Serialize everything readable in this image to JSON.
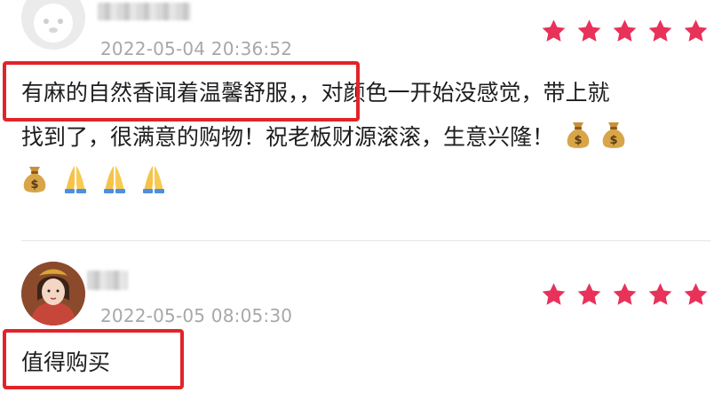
{
  "reviews": [
    {
      "username": "",
      "timestamp": "2022-05-04 20:36:52",
      "rating": 5,
      "text_line1": "有麻的自然香闻着温馨舒服，，对颜色一开始没感觉，带上就",
      "text_line2": "找到了，很满意的购物！祝老板财源滚滚，生意兴隆！",
      "emojis_line2": [
        "money-bag",
        "money-bag"
      ],
      "emojis_line3": [
        "money-bag",
        "folded-hands",
        "folded-hands",
        "folded-hands"
      ]
    },
    {
      "username": "",
      "timestamp": "2022-05-05 08:05:30",
      "rating": 5,
      "text": "值得购买"
    }
  ],
  "colors": {
    "star": "#e8325a",
    "highlight": "#e0242a",
    "timestamp": "#a8a8a8"
  }
}
